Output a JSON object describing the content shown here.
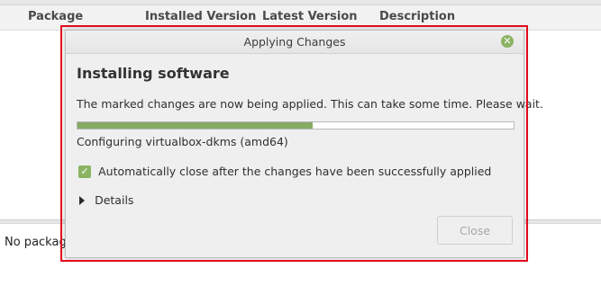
{
  "background_window": {
    "columns": [
      "Package",
      "Installed Version",
      "Latest Version",
      "Description"
    ],
    "details_text": "No package information available."
  },
  "dialog": {
    "title": "Applying Changes",
    "close_icon": "close-icon",
    "heading": "Installing software",
    "message": "The marked changes are now being applied. This can take some time. Please wait.",
    "progress_fraction": 0.54,
    "status": "Configuring virtualbox-dkms (amd64)",
    "auto_close": {
      "checked": true,
      "label": "Automatically close after the changes have been successfully applied"
    },
    "details_label": "Details",
    "close_button": "Close"
  },
  "colors": {
    "accent_green": "#86ab63",
    "highlight_red": "#e4081c"
  }
}
